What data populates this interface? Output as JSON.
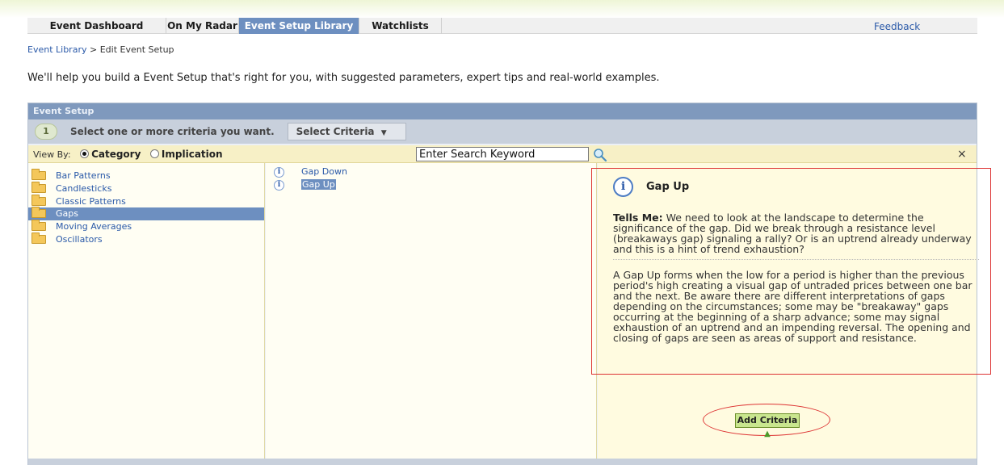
{
  "nav": {
    "tabs": [
      {
        "label": "Event Dashboard",
        "active": false
      },
      {
        "label": "On My Radar",
        "active": false
      },
      {
        "label": "Event Setup Library",
        "active": true
      },
      {
        "label": "Watchlists",
        "active": false
      }
    ],
    "feedback": "Feedback"
  },
  "breadcrumb": {
    "link": "Event Library",
    "separator": " > ",
    "current": "Edit Event Setup"
  },
  "intro": "We'll help you build a Event Setup that's right for you, with suggested parameters, expert tips and real-world examples.",
  "panel": {
    "title": "Event Setup",
    "step_number": "1",
    "step_text": "Select one or more criteria you want.",
    "select_button": "Select Criteria",
    "view_by_label": "View By:",
    "view_options": [
      {
        "label": "Category",
        "selected": true
      },
      {
        "label": "Implication",
        "selected": false
      }
    ],
    "search_value": "Enter Search Keyword",
    "close_symbol": "×"
  },
  "categories": [
    {
      "label": "Bar Patterns",
      "selected": false
    },
    {
      "label": "Candlesticks",
      "selected": false
    },
    {
      "label": "Classic Patterns",
      "selected": false
    },
    {
      "label": "Gaps",
      "selected": true
    },
    {
      "label": "Moving Averages",
      "selected": false
    },
    {
      "label": "Oscillators",
      "selected": false
    }
  ],
  "criteria": [
    {
      "label": "Gap Down",
      "selected": false
    },
    {
      "label": "Gap Up",
      "selected": true
    }
  ],
  "detail": {
    "title": "Gap Up",
    "tells_label": "Tells Me:",
    "tells_text": " We need to look at the landscape to determine the significance of the gap. Did we break through a resistance level (breakaways gap) signaling a rally? Or is an uptrend already underway and this is a hint of trend exhaustion?",
    "description": "A Gap Up forms when the low for a period is higher than the previous period's high creating a visual gap of untraded prices between one bar and the next. Be aware there are different interpretations of gaps depending on the circumstances; some may be \"breakaway\" gaps occurring at the beginning of a sharp advance; some may signal exhaustion of an uptrend and an impending reversal. The opening and closing of gaps are seen as areas of support and resistance.",
    "add_button": "Add Criteria"
  },
  "colors": {
    "active_tab": "#6d8fc0",
    "panel_header": "#7f99bd",
    "highlight_box": "#dd3333",
    "add_button": "#c9e68e"
  }
}
